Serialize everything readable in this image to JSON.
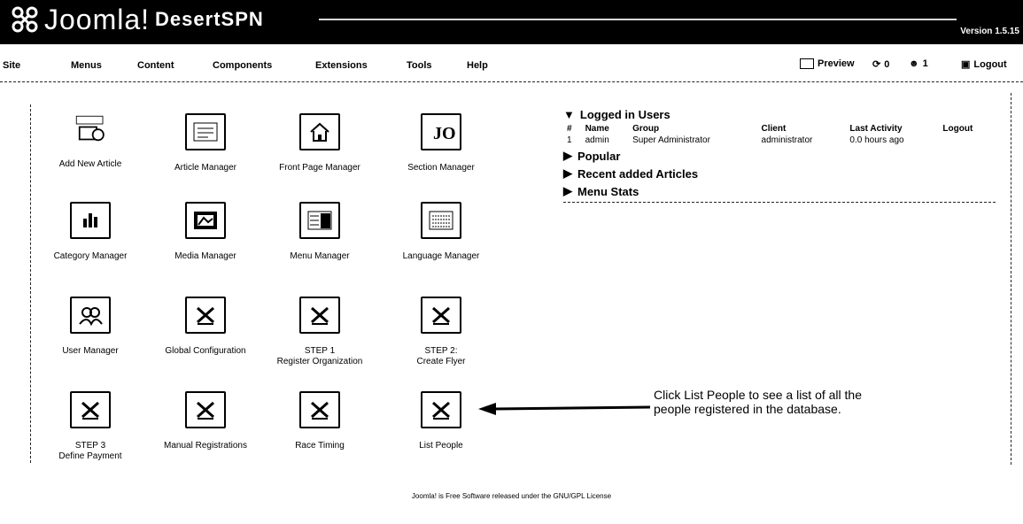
{
  "header": {
    "logo_text": "Joomla!",
    "site_name": "DesertSPN",
    "version": "Version 1.5.15"
  },
  "menu": {
    "items": [
      "Site",
      "Menus",
      "Content",
      "Components",
      "Extensions",
      "Tools",
      "Help"
    ],
    "preview": "Preview",
    "messages": "0",
    "users_online": "1",
    "logout": "Logout"
  },
  "tiles": [
    {
      "label": "Add New Article",
      "icon": "add-article-icon"
    },
    {
      "label": "Article Manager",
      "icon": "article-manager-icon"
    },
    {
      "label": "Front Page Manager",
      "icon": "front-page-icon"
    },
    {
      "label": "Section Manager",
      "icon": "section-manager-icon"
    },
    {
      "label": "Category Manager",
      "icon": "category-manager-icon"
    },
    {
      "label": "Media Manager",
      "icon": "media-manager-icon"
    },
    {
      "label": "Menu Manager",
      "icon": "menu-manager-icon"
    },
    {
      "label": "Language Manager",
      "icon": "language-manager-icon"
    },
    {
      "label": "User Manager",
      "icon": "user-manager-icon"
    },
    {
      "label": "Global Configuration",
      "icon": "tools-icon"
    },
    {
      "label": "STEP 1",
      "label2": "Register Organization",
      "icon": "tools-icon"
    },
    {
      "label": "STEP 2:",
      "label2": "Create Flyer",
      "icon": "tools-icon"
    },
    {
      "label": "STEP 3",
      "label2": "Define Payment",
      "icon": "tools-icon"
    },
    {
      "label": "Manual Registrations",
      "icon": "tools-icon"
    },
    {
      "label": "Race Timing",
      "icon": "tools-icon"
    },
    {
      "label": "List People",
      "icon": "tools-icon"
    }
  ],
  "panel": {
    "logged_in_title": "Logged in Users",
    "columns": [
      "#",
      "Name",
      "Group",
      "Client",
      "Last Activity",
      "Logout"
    ],
    "rows": [
      [
        "1",
        "admin",
        "Super Administrator",
        "administrator",
        "0.0 hours ago",
        ""
      ]
    ],
    "popular": "Popular",
    "recent": "Recent added Articles",
    "menu_stats": "Menu Stats"
  },
  "note": "Click List People to see a list of all the people registered in the database.",
  "footer": "Joomla! is Free Software released under the GNU/GPL License"
}
